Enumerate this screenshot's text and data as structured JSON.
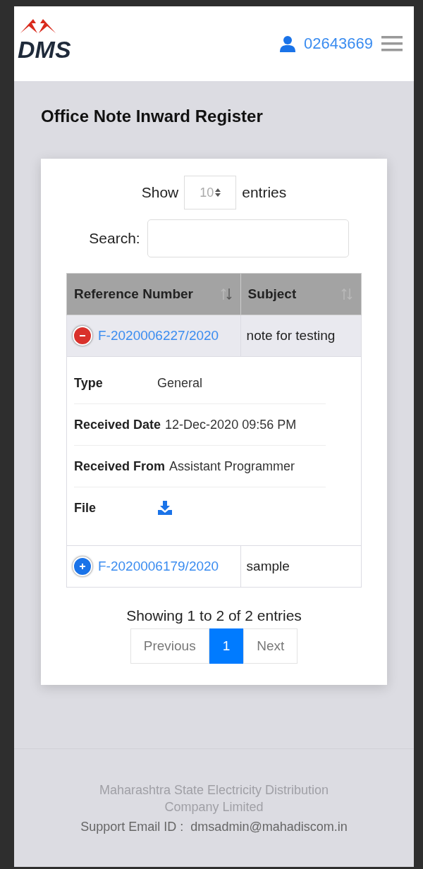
{
  "header": {
    "logo_text": "DMS",
    "user_id": "02643669"
  },
  "page_title": "Office Note Inward Register",
  "length_control": {
    "label_before": "Show",
    "value": "10",
    "label_after": "entries"
  },
  "search": {
    "label": "Search:"
  },
  "table": {
    "columns": [
      "Reference Number",
      "Subject"
    ],
    "rows": [
      {
        "reference": "F-2020006227/2020",
        "subject": "note for testing",
        "expanded": true,
        "details": [
          {
            "kind": "text",
            "label": "Type",
            "value": "General"
          },
          {
            "kind": "text",
            "label": "Received Date",
            "value": "12-Dec-2020 09:56 PM"
          },
          {
            "kind": "text",
            "label": "Received From",
            "value": "Assistant Programmer"
          },
          {
            "kind": "file",
            "label": "File"
          }
        ]
      },
      {
        "reference": "F-2020006179/2020",
        "subject": "sample",
        "expanded": false
      }
    ]
  },
  "info": "Showing 1 to 2 of 2 entries",
  "pagination": [
    {
      "label": "Previous",
      "selected": false
    },
    {
      "label": "1",
      "selected": true
    },
    {
      "label": "Next",
      "selected": false
    }
  ],
  "footer": {
    "company_lines": [
      "Maharashtra State Electricity Distribution",
      "Company Limited"
    ],
    "support_label": "Support Email ID :",
    "support_email": "dmsadmin@mahadiscom.in"
  }
}
